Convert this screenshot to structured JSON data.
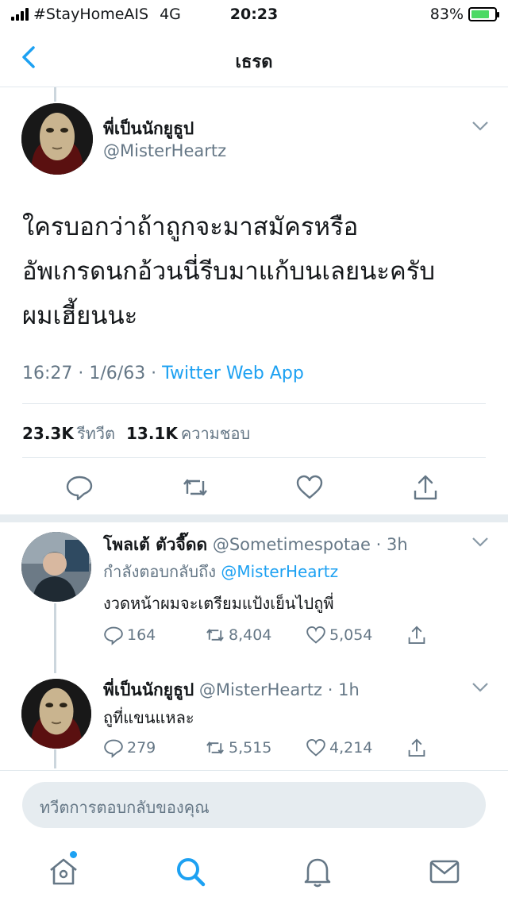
{
  "status_bar": {
    "carrier": "#StayHomeAIS",
    "network": "4G",
    "time": "20:23",
    "battery": "83%"
  },
  "nav": {
    "title": "เธรด",
    "back_icon": "chevron-left-icon"
  },
  "main_tweet": {
    "display_name": "พี่เป็นนักยูธูป",
    "handle": "@MisterHeartz",
    "text_lines": [
      "ใครบอกว่าถ้าถูกจะมาสมัครหรือ",
      "อัพเกรดนกอ้วนนี่รีบมาแก้บนเลยนะครับ",
      "ผมเฮี้ยนนะ"
    ],
    "meta_time": "16:27 · 1/6/63 · ",
    "meta_app": "Twitter Web App",
    "retweets_count": "23.3K",
    "retweets_label": "รีทวีต",
    "likes_count": "13.1K",
    "likes_label": "ความชอบ"
  },
  "replies": [
    {
      "display_name": "โพลเต้ ตัวจี๊ดด",
      "handle_time": "@Sometimespotae · 3h",
      "replying_prefix": "กำลังตอบกลับถึง",
      "replying_to": "@MisterHeartz",
      "text": "งวดหน้าผมจะเตรียมแป้งเย็นไปถูพี่",
      "replies": "164",
      "retweets": "8,404",
      "likes": "5,054"
    },
    {
      "display_name": "พี่เป็นนักยูธูป",
      "handle_time": "@MisterHeartz · 1h",
      "text": "ถูที่แขนแหละ",
      "replies": "279",
      "retweets": "5,515",
      "likes": "4,214"
    }
  ],
  "compose": {
    "placeholder": "ทวีตการตอบกลับของคุณ"
  },
  "tabs": [
    "home-icon",
    "search-icon",
    "bell-icon",
    "mail-icon"
  ],
  "colors": {
    "accent": "#1da1f2",
    "secondary_text": "#657786",
    "divider": "#e1e8ed",
    "battery_fill": "#4cd964"
  }
}
